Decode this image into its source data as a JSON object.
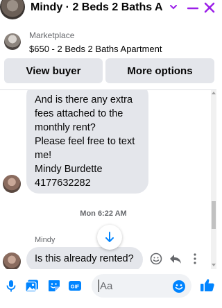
{
  "header": {
    "title": "Mindy · 2 Beds 2 Baths Ap...",
    "icons": [
      "avatar",
      "chevron-down-icon",
      "minimize-icon",
      "close-icon"
    ],
    "accent_color": "#9b1fe8"
  },
  "listing": {
    "source": "Marketplace",
    "item": "$650 - 2 Beds 2 Baths Apartment"
  },
  "actions": {
    "view_buyer": "View buyer",
    "more_options": "More options"
  },
  "thread": {
    "first_message_lines": [
      "And is there any extra",
      "fees attached to the",
      "monthly rent?",
      "Please feel free to text",
      "me!",
      "Mindy Burdette",
      "4177632282"
    ],
    "timestamp": "Mon 6:22 AM",
    "sender": "Mindy",
    "second_message": "Is this already rented?"
  },
  "composer": {
    "placeholder": "Aa",
    "icons": [
      "mic-icon",
      "photo-icon",
      "sticker-icon",
      "gif-icon",
      "emoji-icon",
      "like-icon"
    ],
    "gif_label": "GIF",
    "icon_color": "#0084ff"
  }
}
